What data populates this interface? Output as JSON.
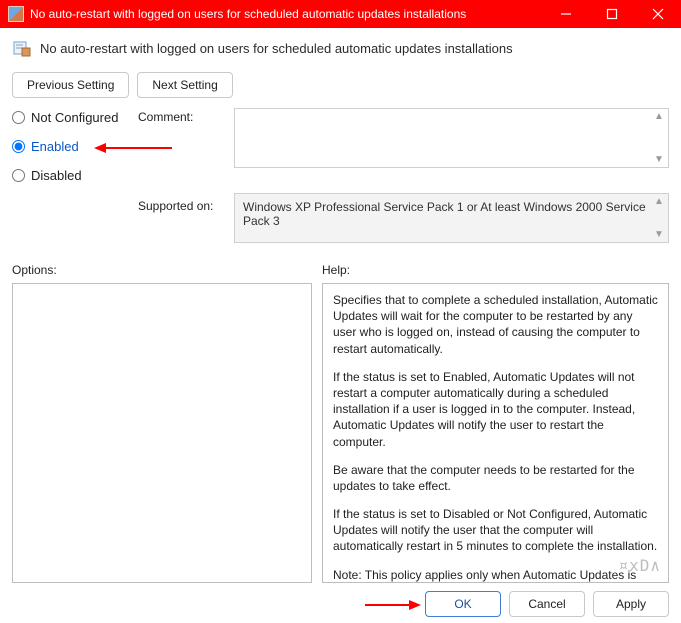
{
  "titlebar": {
    "title": "No auto-restart with logged on users for scheduled automatic updates installations"
  },
  "heading": "No auto-restart with logged on users for scheduled automatic updates installations",
  "nav": {
    "prev": "Previous Setting",
    "next": "Next Setting"
  },
  "radios": {
    "not_configured": "Not Configured",
    "enabled": "Enabled",
    "disabled": "Disabled",
    "selected": "enabled"
  },
  "labels": {
    "comment": "Comment:",
    "supported_on": "Supported on:",
    "options": "Options:",
    "help": "Help:"
  },
  "supported_on_text": "Windows XP Professional Service Pack 1 or At least Windows 2000 Service Pack 3",
  "help_paragraphs": [
    "Specifies that to complete a scheduled installation, Automatic Updates will wait for the computer to be restarted by any user who is logged on, instead of causing the computer to restart automatically.",
    "If the status is set to Enabled, Automatic Updates will not restart a computer automatically during a scheduled installation if a user is logged in to the computer. Instead, Automatic Updates will notify the user to restart the computer.",
    "Be aware that the computer needs to be restarted for the updates to take effect.",
    "If the status is set to Disabled or Not Configured, Automatic Updates will notify the user that the computer will automatically restart in 5 minutes to complete the installation.",
    "Note: This policy applies only when Automatic Updates is configured to perform scheduled installations of updates. If the \"Configure Automatic Updates\" policy is disabled, this policy has"
  ],
  "buttons": {
    "ok": "OK",
    "cancel": "Cancel",
    "apply": "Apply"
  },
  "watermark": "¤xD∧"
}
